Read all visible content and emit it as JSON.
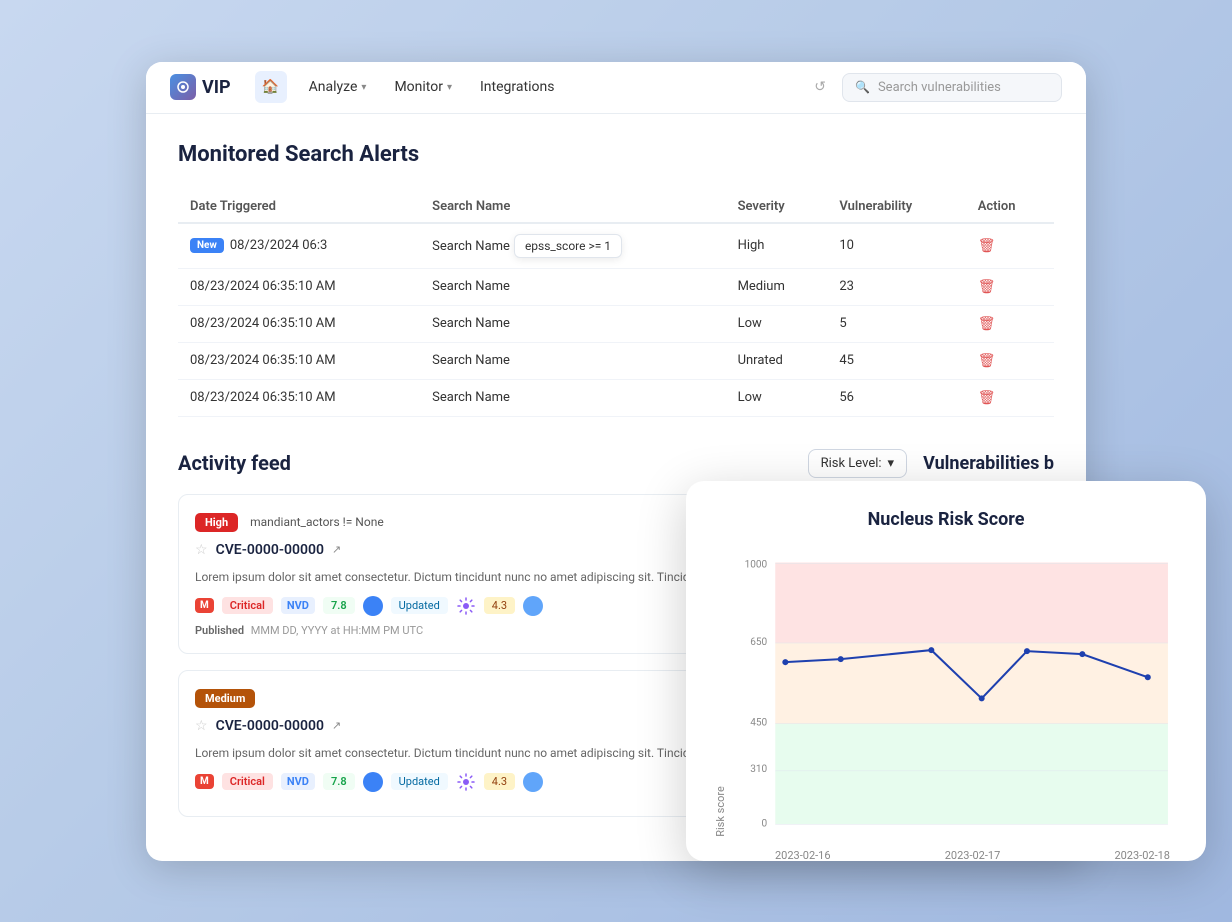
{
  "app": {
    "logo_text": "VIP",
    "nav_items": [
      {
        "label": "Analyze",
        "has_chevron": true
      },
      {
        "label": "Monitor",
        "has_chevron": true
      },
      {
        "label": "Integrations",
        "has_chevron": false
      }
    ],
    "search_placeholder": "Search vulnerabilities"
  },
  "monitored_alerts": {
    "title": "Monitored Search Alerts",
    "columns": [
      "Date Triggered",
      "Search Name",
      "Severity",
      "Vulnerability",
      "Action"
    ],
    "rows": [
      {
        "badge": "New",
        "date": "08/23/2024 06:3",
        "search_name": "Search Name",
        "tooltip": "epss_score >= 1",
        "severity": "High",
        "vulnerability": "10"
      },
      {
        "badge": null,
        "date": "08/23/2024 06:35:10 AM",
        "search_name": "Search Name",
        "tooltip": null,
        "severity": "Medium",
        "vulnerability": "23"
      },
      {
        "badge": null,
        "date": "08/23/2024 06:35:10 AM",
        "search_name": "Search Name",
        "tooltip": null,
        "severity": "Low",
        "vulnerability": "5"
      },
      {
        "badge": null,
        "date": "08/23/2024 06:35:10 AM",
        "search_name": "Search Name",
        "tooltip": null,
        "severity": "Unrated",
        "vulnerability": "45"
      },
      {
        "badge": null,
        "date": "08/23/2024 06:35:10 AM",
        "search_name": "Search Name",
        "tooltip": null,
        "severity": "Low",
        "vulnerability": "56"
      }
    ]
  },
  "activity_feed": {
    "title": "Activity feed",
    "risk_level_label": "Risk Level:",
    "vuln_header": "Vulnerabilities b",
    "cards": [
      {
        "severity": "High",
        "filter": "mandiant_actors != None",
        "cve": "CVE-0000-00000",
        "description": "Lorem ipsum dolor sit amet consectetur. Dictum tincidunt nunc no amet adipiscing sit. Tincidunt sem sed massa dolor tellus pretium p",
        "tags": [
          {
            "type": "logo_m",
            "color": "#ea4335"
          },
          {
            "type": "critical",
            "label": "Critical"
          },
          {
            "type": "nvd",
            "label": "NVD"
          },
          {
            "type": "score",
            "label": "7.8"
          },
          {
            "type": "circle",
            "color": "#3b82f6"
          },
          {
            "type": "updated",
            "label": "Updated"
          },
          {
            "type": "gear",
            "color": "#8b5cf6"
          },
          {
            "type": "score43",
            "label": "4.3"
          },
          {
            "type": "circle2",
            "color": "#60a5fa"
          }
        ],
        "published_label": "Published",
        "published_date": "MMM DD, YYYY at HH:MM PM UTC"
      },
      {
        "severity": "Medium",
        "filter": null,
        "cve": "CVE-0000-00000",
        "description": "Lorem ipsum dolor sit amet consectetur. Dictum tincidunt nunc no amet adipiscing sit. Tincidunt sem sed massa dolor tellus pretium",
        "tags": [
          {
            "type": "logo_m",
            "color": "#ea4335"
          },
          {
            "type": "critical",
            "label": "Critical"
          },
          {
            "type": "nvd",
            "label": "NVD"
          },
          {
            "type": "score",
            "label": "7.8"
          },
          {
            "type": "circle",
            "color": "#3b82f6"
          },
          {
            "type": "updated",
            "label": "Updated"
          },
          {
            "type": "gear",
            "color": "#8b5cf6"
          },
          {
            "type": "score43",
            "label": "4.3"
          },
          {
            "type": "circle2",
            "color": "#60a5fa"
          }
        ],
        "published_label": "Published",
        "published_date": "MMM DD, YYYY at HH:MM PM UTC"
      }
    ]
  },
  "chart": {
    "title": "Nucleus Risk Score",
    "y_label": "Risk score",
    "y_ticks": [
      "1000",
      "650",
      "450",
      "310",
      "0"
    ],
    "x_labels": [
      "2023-02-16",
      "2023-02-17",
      "2023-02-18"
    ],
    "zones": [
      {
        "label": "high",
        "color": "rgba(248,113,113,0.25)",
        "y_start": 0,
        "y_end": 35
      },
      {
        "label": "medium",
        "color": "rgba(253,186,116,0.25)",
        "y_start": 35,
        "y_end": 58
      },
      {
        "label": "low",
        "color": "rgba(134,239,172,0.25)",
        "y_start": 58,
        "y_end": 100
      }
    ],
    "data_points": [
      {
        "x": "2023-02-16",
        "score": 620
      },
      {
        "x": "2023-02-16.5",
        "score": 630
      },
      {
        "x": "2023-02-17",
        "score": 665
      },
      {
        "x": "2023-02-17.3",
        "score": 480
      },
      {
        "x": "2023-02-17.7",
        "score": 660
      },
      {
        "x": "2023-02-18",
        "score": 650
      },
      {
        "x": "2023-02-18.5",
        "score": 560
      }
    ]
  }
}
